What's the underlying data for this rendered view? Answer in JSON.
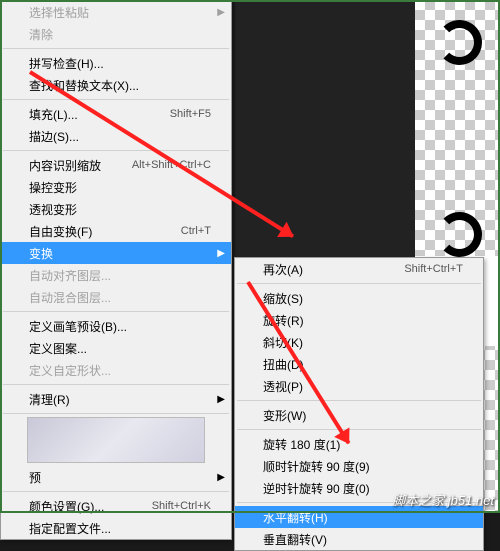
{
  "main_menu": {
    "items": [
      {
        "label": "选择性粘贴",
        "shortcut": "",
        "arrow": true,
        "dis": true
      },
      {
        "label": "清除",
        "shortcut": "",
        "dis": true
      },
      {
        "sep": true
      },
      {
        "label": "拼写检查(H)...",
        "shortcut": ""
      },
      {
        "label": "查找和替换文本(X)...",
        "shortcut": ""
      },
      {
        "sep": true
      },
      {
        "label": "填充(L)...",
        "shortcut": "Shift+F5"
      },
      {
        "label": "描边(S)...",
        "shortcut": ""
      },
      {
        "sep": true
      },
      {
        "label": "内容识别缩放",
        "shortcut": "Alt+Shift+Ctrl+C"
      },
      {
        "label": "操控变形",
        "shortcut": ""
      },
      {
        "label": "透视变形",
        "shortcut": ""
      },
      {
        "label": "自由变换(F)",
        "shortcut": "Ctrl+T"
      },
      {
        "label": "变换",
        "shortcut": "",
        "arrow": true,
        "hl": true
      },
      {
        "label": "自动对齐图层...",
        "shortcut": "",
        "dis": true
      },
      {
        "label": "自动混合图层...",
        "shortcut": "",
        "dis": true
      },
      {
        "sep": true
      },
      {
        "label": "定义画笔预设(B)...",
        "shortcut": ""
      },
      {
        "label": "定义图案...",
        "shortcut": ""
      },
      {
        "label": "定义自定形状...",
        "shortcut": "",
        "dis": true
      },
      {
        "sep": true
      },
      {
        "label": "清理(R)",
        "shortcut": "",
        "arrow": true
      },
      {
        "sep": true
      },
      {
        "preview": true
      },
      {
        "label": "预",
        "shortcut": "",
        "arrow": true
      },
      {
        "sep": true
      },
      {
        "label": "颜色设置(G)...",
        "shortcut": "Shift+Ctrl+K"
      },
      {
        "label": "指定配置文件...",
        "shortcut": ""
      }
    ]
  },
  "sub_menu": {
    "items": [
      {
        "label": "再次(A)",
        "shortcut": "Shift+Ctrl+T"
      },
      {
        "sep": true
      },
      {
        "label": "缩放(S)",
        "shortcut": ""
      },
      {
        "label": "旋转(R)",
        "shortcut": ""
      },
      {
        "label": "斜切(K)",
        "shortcut": ""
      },
      {
        "label": "扭曲(D)",
        "shortcut": ""
      },
      {
        "label": "透视(P)",
        "shortcut": ""
      },
      {
        "sep": true
      },
      {
        "label": "变形(W)",
        "shortcut": ""
      },
      {
        "sep": true
      },
      {
        "label": "旋转 180 度(1)",
        "shortcut": ""
      },
      {
        "label": "顺时针旋转 90 度(9)",
        "shortcut": ""
      },
      {
        "label": "逆时针旋转 90 度(0)",
        "shortcut": ""
      },
      {
        "sep": true
      },
      {
        "label": "水平翻转(H)",
        "shortcut": "",
        "hl": true
      },
      {
        "label": "垂直翻转(V)",
        "shortcut": ""
      }
    ]
  },
  "watermark": "脚本之家 jb51.net"
}
